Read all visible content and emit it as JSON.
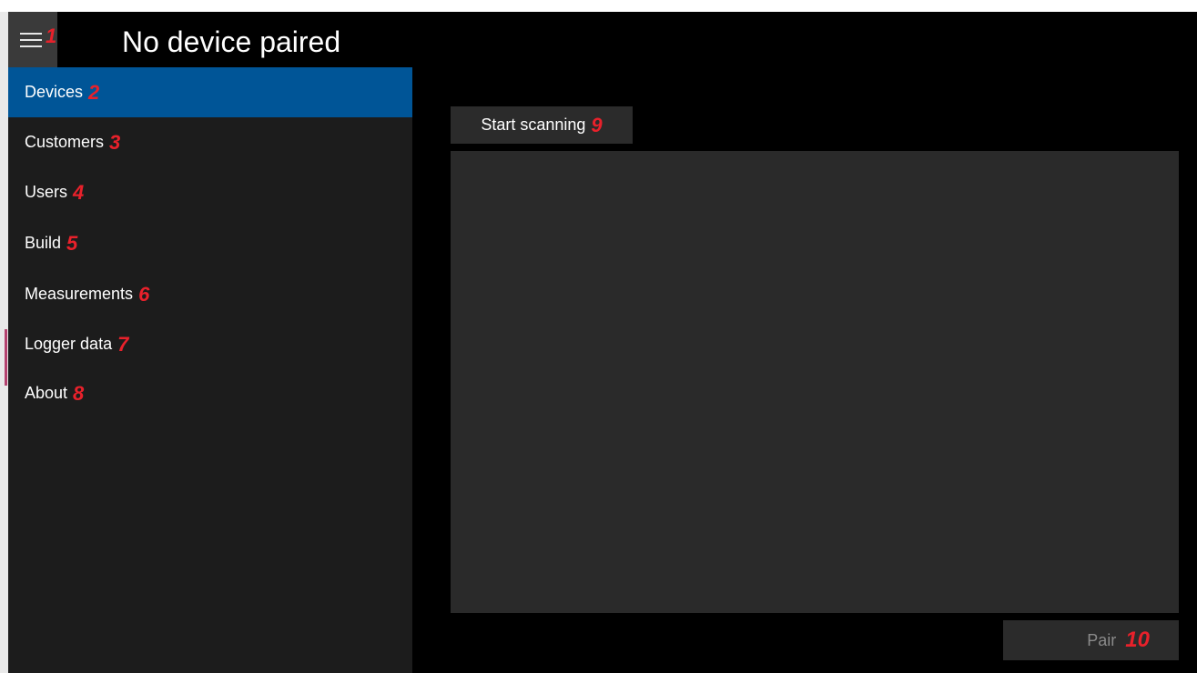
{
  "header": {
    "title": "No device paired",
    "menu_icon": "hamburger-menu-icon",
    "menu_badge": "1"
  },
  "nav": {
    "items": [
      {
        "label": "Devices",
        "badge": "2",
        "selected": true
      },
      {
        "label": "Customers",
        "badge": "3"
      },
      {
        "label": "Users",
        "badge": "4"
      },
      {
        "label": "Build",
        "badge": "5"
      },
      {
        "label": "Measurements",
        "badge": "6"
      },
      {
        "label": "Logger data",
        "badge": "7"
      },
      {
        "label": "About",
        "badge": "8"
      }
    ]
  },
  "main": {
    "scan_button": {
      "label": "Start scanning",
      "badge": "9"
    },
    "pair_button": {
      "label": "Pair",
      "badge": "10"
    }
  },
  "colors": {
    "background": "#000000",
    "nav_background": "#1c1c1c",
    "selected": "#005597",
    "badge": "#e8212b",
    "panel": "#2a2a2a"
  }
}
